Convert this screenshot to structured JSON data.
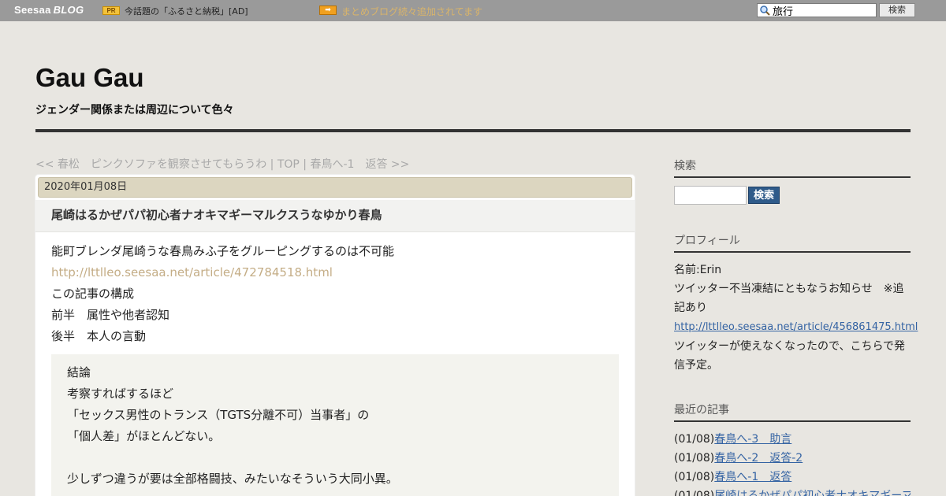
{
  "topbar": {
    "logo_seesaa": "Seesaa",
    "logo_blog": "BLOG",
    "pr_badge": "PR",
    "pr_text": "今話題の「ふるさと納税」[AD]",
    "arrow_badge": "➡",
    "link_text": "まとめブログ続々追加されてます",
    "search_value": "旅行",
    "search_button": "検索"
  },
  "header": {
    "title": "Gau Gau",
    "description": "ジェンダー関係または周辺について色々"
  },
  "nav": {
    "prev": "<< 春松　ピンクソファを観察させてもらうわ",
    "sep1": " | ",
    "top": "TOP",
    "sep2": " | ",
    "next": "春鳥へ-1　返答 >>"
  },
  "article": {
    "date": "2020年01月08日",
    "title": "尾崎はるかぜパパ初心者ナオキマギーマルクスうなゆかり春鳥",
    "lines": [
      "能町ブレンダ尾崎うな春鳥みふ子をグルーピングするのは不可能",
      "http://lttlleo.seesaa.net/article/472784518.html",
      "この記事の構成",
      "前半　属性や他者認知",
      "後半　本人の言動"
    ],
    "quote_lines": [
      "結論",
      "考察すればするほど",
      "「セックス男性のトランス（TGTS分離不可）当事者」の",
      "「個人差」がほとんどない。",
      "",
      "少しずつ違うが要は全部格闘技、みたいなそういう大同小異。"
    ]
  },
  "sidebar": {
    "search": {
      "heading": "検索",
      "button": "検索"
    },
    "profile": {
      "heading": "プロフィール",
      "name": "名前:Erin",
      "notice": "ツイッター不当凍結にともなうお知らせ　※追記あり",
      "url": "http://lttlleo.seesaa.net/article/456861475.html",
      "note": "ツイッターが使えなくなったので、こちらで発信予定。"
    },
    "recent": {
      "heading": "最近の記事",
      "items": [
        {
          "date": "(01/08)",
          "title": "春鳥へ-3　助言"
        },
        {
          "date": "(01/08)",
          "title": "春鳥へ-2　返答-2"
        },
        {
          "date": "(01/08)",
          "title": "春鳥へ-1　返答"
        },
        {
          "date": "(01/08)",
          "title": "尾崎はるかぜパパ初心者ナオキマギーマ"
        }
      ]
    }
  },
  "colors": {
    "topbar": "#9a9a9a",
    "page_bg": "#e8e6e1",
    "date_bar": "#dcd6c0",
    "link": "#3463a3",
    "muted_link": "#c4ad86",
    "search_button": "#2f5b8a"
  }
}
